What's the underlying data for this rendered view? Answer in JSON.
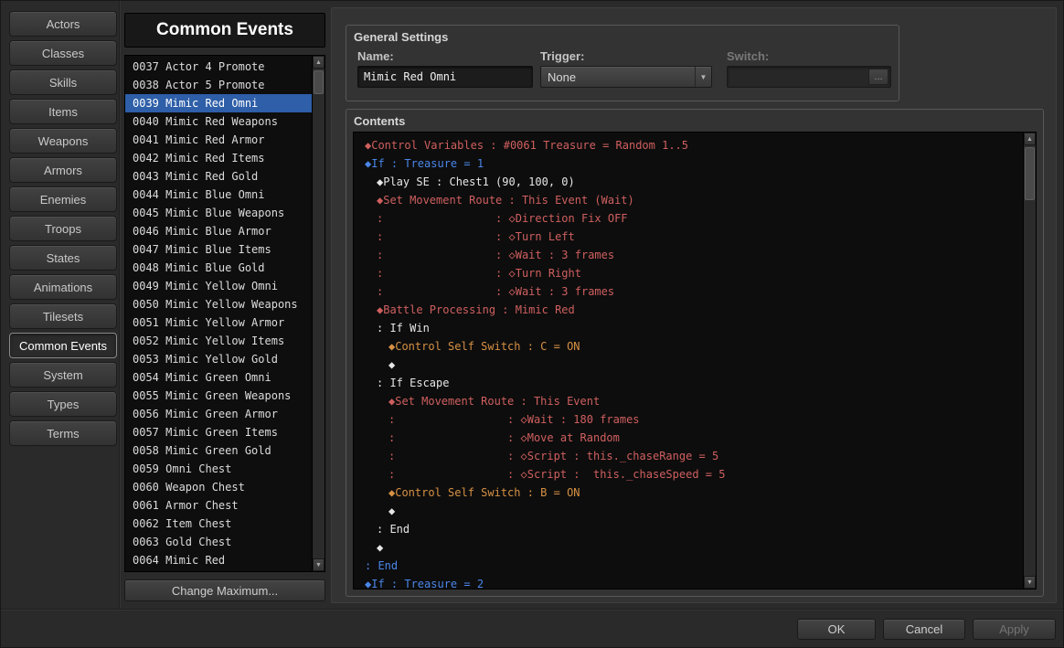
{
  "colors": {
    "selection": "#2e5fa8",
    "code": {
      "crimson": "#d05f5f",
      "blue": "#4a86e8",
      "orange": "#d79144",
      "white": "#e6e6e6"
    }
  },
  "icons": {
    "scroll_up": "▲",
    "scroll_down": "▼",
    "dropdown_arrow": "▼"
  },
  "sidebar": {
    "items": [
      {
        "label": "Actors",
        "selected": false
      },
      {
        "label": "Classes",
        "selected": false
      },
      {
        "label": "Skills",
        "selected": false
      },
      {
        "label": "Items",
        "selected": false
      },
      {
        "label": "Weapons",
        "selected": false
      },
      {
        "label": "Armors",
        "selected": false
      },
      {
        "label": "Enemies",
        "selected": false
      },
      {
        "label": "Troops",
        "selected": false
      },
      {
        "label": "States",
        "selected": false
      },
      {
        "label": "Animations",
        "selected": false
      },
      {
        "label": "Tilesets",
        "selected": false
      },
      {
        "label": "Common Events",
        "selected": true
      },
      {
        "label": "System",
        "selected": false
      },
      {
        "label": "Types",
        "selected": false
      },
      {
        "label": "Terms",
        "selected": false
      }
    ]
  },
  "event_list": {
    "title": "Common Events",
    "selected_index": 2,
    "items": [
      {
        "id": "0037",
        "name": "Actor 4 Promote"
      },
      {
        "id": "0038",
        "name": "Actor 5 Promote"
      },
      {
        "id": "0039",
        "name": "Mimic Red Omni"
      },
      {
        "id": "0040",
        "name": "Mimic Red Weapons"
      },
      {
        "id": "0041",
        "name": "Mimic Red Armor"
      },
      {
        "id": "0042",
        "name": "Mimic Red Items"
      },
      {
        "id": "0043",
        "name": "Mimic Red Gold"
      },
      {
        "id": "0044",
        "name": "Mimic Blue Omni"
      },
      {
        "id": "0045",
        "name": "Mimic Blue Weapons"
      },
      {
        "id": "0046",
        "name": "Mimic Blue Armor"
      },
      {
        "id": "0047",
        "name": "Mimic Blue Items"
      },
      {
        "id": "0048",
        "name": "Mimic Blue Gold"
      },
      {
        "id": "0049",
        "name": "Mimic Yellow Omni"
      },
      {
        "id": "0050",
        "name": "Mimic Yellow Weapons"
      },
      {
        "id": "0051",
        "name": "Mimic Yellow Armor"
      },
      {
        "id": "0052",
        "name": "Mimic Yellow Items"
      },
      {
        "id": "0053",
        "name": "Mimic Yellow Gold"
      },
      {
        "id": "0054",
        "name": "Mimic Green Omni"
      },
      {
        "id": "0055",
        "name": "Mimic Green Weapons"
      },
      {
        "id": "0056",
        "name": "Mimic Green Armor"
      },
      {
        "id": "0057",
        "name": "Mimic Green Items"
      },
      {
        "id": "0058",
        "name": "Mimic Green Gold"
      },
      {
        "id": "0059",
        "name": "Omni Chest"
      },
      {
        "id": "0060",
        "name": "Weapon Chest"
      },
      {
        "id": "0061",
        "name": "Armor Chest"
      },
      {
        "id": "0062",
        "name": "Item Chest"
      },
      {
        "id": "0063",
        "name": "Gold Chest"
      },
      {
        "id": "0064",
        "name": "Mimic Red"
      }
    ],
    "change_max_label": "Change Maximum..."
  },
  "general_settings": {
    "title": "General Settings",
    "name_label": "Name:",
    "name_value": "Mimic Red Omni",
    "trigger_label": "Trigger:",
    "trigger_value": "None",
    "switch_label": "Switch:",
    "switch_value": "",
    "switch_browse_label": "..."
  },
  "contents": {
    "title": "Contents",
    "lines": [
      {
        "text": "◆Control Variables : #0061 Treasure = Random 1..5",
        "color": "crimson",
        "indent": 0
      },
      {
        "text": "◆If : Treasure = 1",
        "color": "blue",
        "indent": 0
      },
      {
        "text": "◆Play SE : Chest1 (90, 100, 0)",
        "color": "white",
        "indent": 1
      },
      {
        "text": "◆Set Movement Route : This Event (Wait)",
        "color": "crimson",
        "indent": 1
      },
      {
        "text": ":                 : ◇Direction Fix OFF",
        "color": "crimson",
        "indent": 1
      },
      {
        "text": ":                 : ◇Turn Left",
        "color": "crimson",
        "indent": 1
      },
      {
        "text": ":                 : ◇Wait : 3 frames",
        "color": "crimson",
        "indent": 1
      },
      {
        "text": ":                 : ◇Turn Right",
        "color": "crimson",
        "indent": 1
      },
      {
        "text": ":                 : ◇Wait : 3 frames",
        "color": "crimson",
        "indent": 1
      },
      {
        "text": "◆Battle Processing : Mimic Red",
        "color": "crimson",
        "indent": 1
      },
      {
        "text": ": If Win",
        "color": "white",
        "indent": 1
      },
      {
        "text": "◆Control Self Switch : C = ON",
        "color": "orange",
        "indent": 2
      },
      {
        "text": "◆",
        "color": "white",
        "indent": 2
      },
      {
        "text": ": If Escape",
        "color": "white",
        "indent": 1
      },
      {
        "text": "◆Set Movement Route : This Event",
        "color": "crimson",
        "indent": 2
      },
      {
        "text": ":                 : ◇Wait : 180 frames",
        "color": "crimson",
        "indent": 2
      },
      {
        "text": ":                 : ◇Move at Random",
        "color": "crimson",
        "indent": 2
      },
      {
        "text": ":                 : ◇Script : this._chaseRange = 5",
        "color": "crimson",
        "indent": 2
      },
      {
        "text": ":                 : ◇Script :  this._chaseSpeed = 5",
        "color": "crimson",
        "indent": 2
      },
      {
        "text": "◆Control Self Switch : B = ON",
        "color": "orange",
        "indent": 2
      },
      {
        "text": "◆",
        "color": "white",
        "indent": 2
      },
      {
        "text": ": End",
        "color": "white",
        "indent": 1
      },
      {
        "text": "◆",
        "color": "white",
        "indent": 1
      },
      {
        "text": ": End",
        "color": "blue",
        "indent": 0
      },
      {
        "text": "◆If : Treasure = 2",
        "color": "blue",
        "indent": 0
      }
    ]
  },
  "footer": {
    "ok_label": "OK",
    "cancel_label": "Cancel",
    "apply_label": "Apply"
  }
}
